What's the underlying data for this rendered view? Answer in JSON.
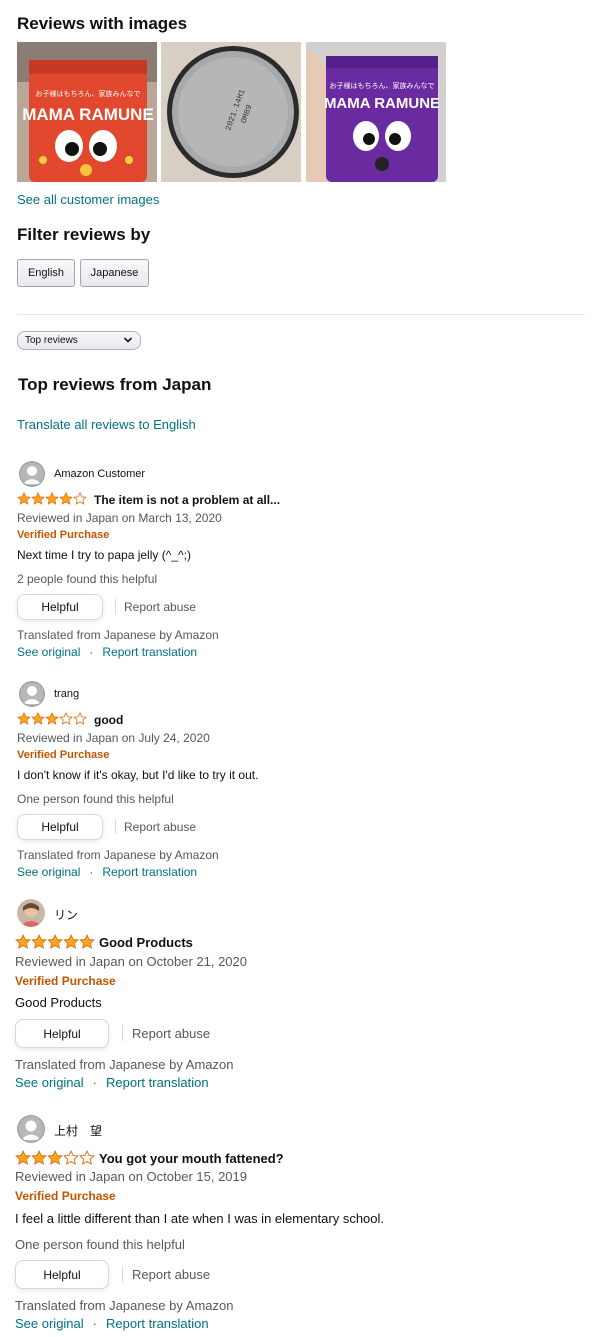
{
  "images_section": {
    "heading": "Reviews with images",
    "see_all_label": "See all customer images",
    "images": [
      {
        "icon": "red-mama-ramune-can-image"
      },
      {
        "icon": "can-lid-image",
        "lid_text_1": "2021.14H1",
        "lid_text_2": "OM89"
      },
      {
        "icon": "purple-mama-ramune-can-image"
      }
    ]
  },
  "filter": {
    "heading": "Filter reviews by",
    "buttons": [
      "English",
      "Japanese"
    ]
  },
  "sort": {
    "selected": "Top reviews"
  },
  "reviews_section": {
    "heading": "Top reviews from Japan",
    "translate_all_label": "Translate all reviews to English"
  },
  "reviews": [
    {
      "name": "Amazon Customer",
      "rating": 4,
      "title": "The item is not a problem at all...",
      "date": "Reviewed in Japan on March 13, 2020",
      "verified": "Verified Purchase",
      "body": "Next time I try to papa jelly (^_^;)",
      "helpful_count": "2 people found this helpful",
      "helpful_label": "Helpful",
      "report_label": "Report abuse",
      "translated": "Translated from Japanese by Amazon",
      "see_original": "See original",
      "report_translation": "Report translation",
      "avatar": "default"
    },
    {
      "name": "trang",
      "rating": 3,
      "title": "good",
      "date": "Reviewed in Japan on July 24, 2020",
      "verified": "Verified Purchase",
      "body": "I don't know if it's okay, but I'd like to try it out.",
      "helpful_count": "One person found this helpful",
      "helpful_label": "Helpful",
      "report_label": "Report abuse",
      "translated": "Translated from Japanese by Amazon",
      "see_original": "See original",
      "report_translation": "Report translation",
      "avatar": "default"
    },
    {
      "name": "リン",
      "rating": 5,
      "title": "Good Products",
      "date": "Reviewed in Japan on October 21, 2020",
      "verified": "Verified Purchase",
      "body": "Good Products",
      "helpful_label": "Helpful",
      "report_label": "Report abuse",
      "translated": "Translated from Japanese by Amazon",
      "see_original": "See original",
      "report_translation": "Report translation",
      "avatar": "photo"
    },
    {
      "name": "上村　望",
      "rating": 3,
      "title": "You got your mouth fattened?",
      "date": "Reviewed in Japan on October 15, 2019",
      "verified": "Verified Purchase",
      "body": "I feel a little different than I ate when I was in elementary school.",
      "helpful_count": "One person found this helpful",
      "helpful_label": "Helpful",
      "report_label": "Report abuse",
      "translated": "Translated from Japanese by Amazon",
      "see_original": "See original",
      "report_translation": "Report translation",
      "avatar": "default"
    }
  ],
  "colors": {
    "star": "#ffa41c",
    "star_outline": "#de7921",
    "link": "#007185",
    "verified": "#c45500",
    "muted": "#565959"
  }
}
